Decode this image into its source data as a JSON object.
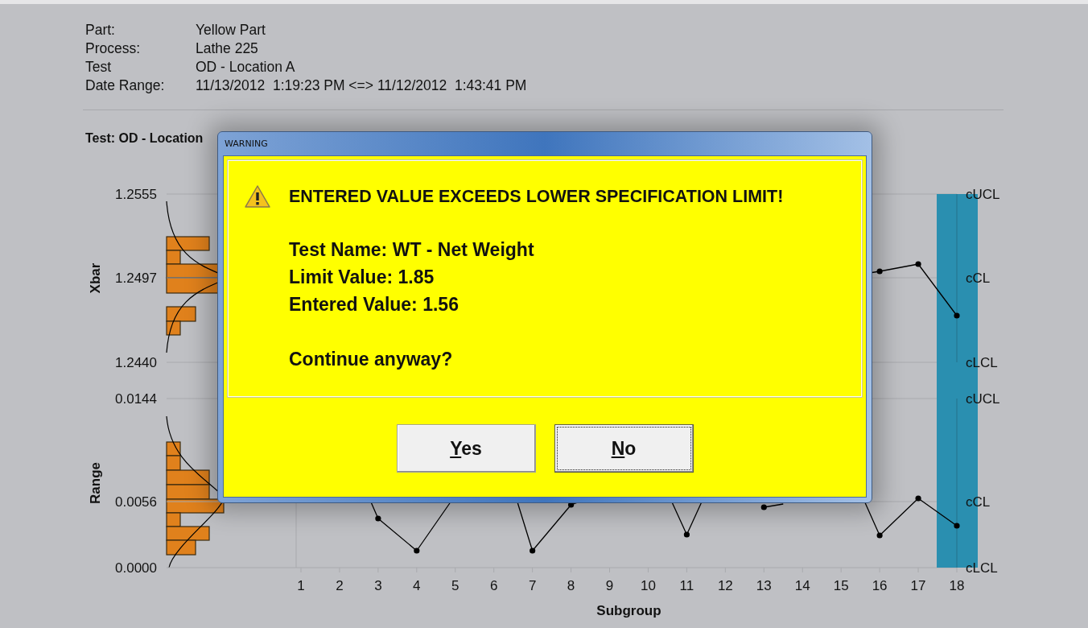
{
  "header": {
    "fields": [
      {
        "label": "Part:",
        "value": "Yellow Part"
      },
      {
        "label": "Process:",
        "value": "Lathe 225"
      },
      {
        "label": "Test",
        "value": "OD - Location A"
      },
      {
        "label": "Date Range:",
        "value": "11/13/2012  1:19:23 PM <=> 11/12/2012  1:43:41 PM"
      }
    ]
  },
  "chart_title": "Test: OD - Location",
  "charts": [
    {
      "ylabel": "Xbar",
      "ytick_labels": [
        "1.2555",
        "1.2497",
        "1.2440"
      ],
      "limit_labels": [
        "cUCL",
        "cCL",
        "cLCL"
      ]
    },
    {
      "ylabel": "Range",
      "ytick_labels": [
        "0.0144",
        "0.0056",
        "0.0000"
      ],
      "limit_labels": [
        "cUCL",
        "cCL",
        "cLCL"
      ]
    }
  ],
  "x_axis": {
    "labels": [
      "1",
      "2",
      "3",
      "4",
      "5",
      "6",
      "7",
      "8",
      "9",
      "10",
      "11",
      "12",
      "13",
      "14",
      "15",
      "16",
      "17",
      "18"
    ],
    "title": "Subgroup"
  },
  "dialog": {
    "title": "WARNING",
    "headline": "ENTERED VALUE EXCEEDS LOWER SPECIFICATION LIMIT!",
    "lines": [
      "Test Name: WT - Net Weight",
      "Limit Value: 1.85",
      "Entered Value: 1.56"
    ],
    "question": "Continue anyway?",
    "buttons": [
      {
        "label": "Yes",
        "focused": false
      },
      {
        "label": "No",
        "focused": true
      }
    ]
  }
}
